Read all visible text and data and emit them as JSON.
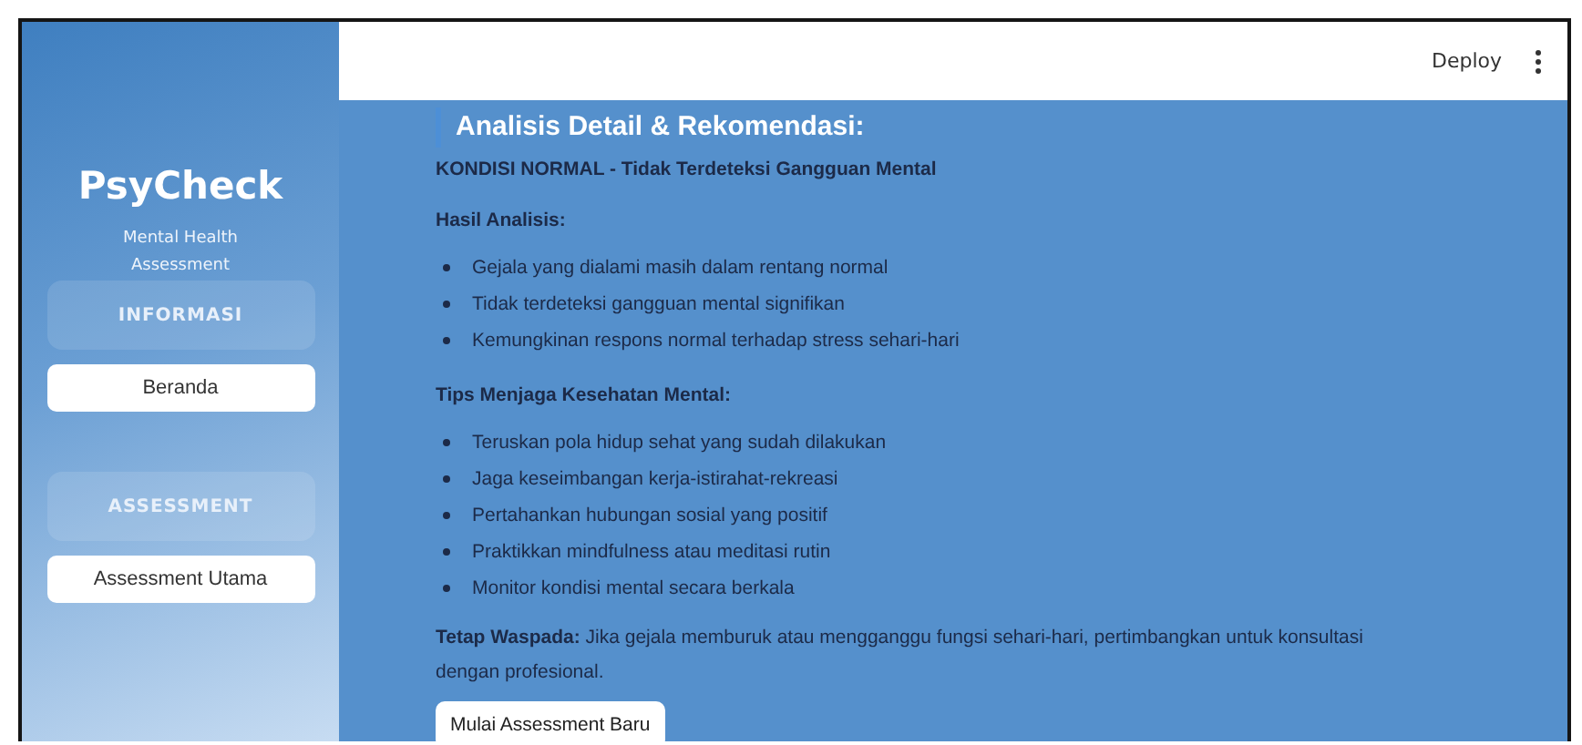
{
  "sidebar": {
    "title": "PsyCheck",
    "subtitle": "Mental Health Assessment",
    "sections": [
      {
        "heading": "INFORMASI",
        "items": [
          {
            "label": "Beranda"
          }
        ]
      },
      {
        "heading": "ASSESSMENT",
        "items": [
          {
            "label": "Assessment Utama"
          }
        ]
      }
    ]
  },
  "header": {
    "deploy": "Deploy"
  },
  "main": {
    "heading": "Analisis Detail & Rekomendasi:",
    "status": "KONDISI NORMAL - Tidak Terdeteksi Gangguan Mental",
    "groups": [
      {
        "title": "Hasil Analisis:",
        "items": [
          "Gejala yang dialami masih dalam rentang normal",
          "Tidak terdeteksi gangguan mental signifikan",
          "Kemungkinan respons normal terhadap stress sehari-hari"
        ]
      },
      {
        "title": "Tips Menjaga Kesehatan Mental:",
        "items": [
          "Teruskan pola hidup sehat yang sudah dilakukan",
          "Jaga keseimbangan kerja-istirahat-rekreasi",
          "Pertahankan hubungan sosial yang positif",
          "Praktikkan mindfulness atau meditasi rutin",
          "Monitor kondisi mental secara berkala"
        ]
      }
    ],
    "note": "**Tetap Waspada:** Jika gejala memburuk atau mengganggu fungsi sehari-hari, pertimbangkan untuk konsultasi dengan profesional.",
    "button": "Mulai Assessment Baru"
  }
}
